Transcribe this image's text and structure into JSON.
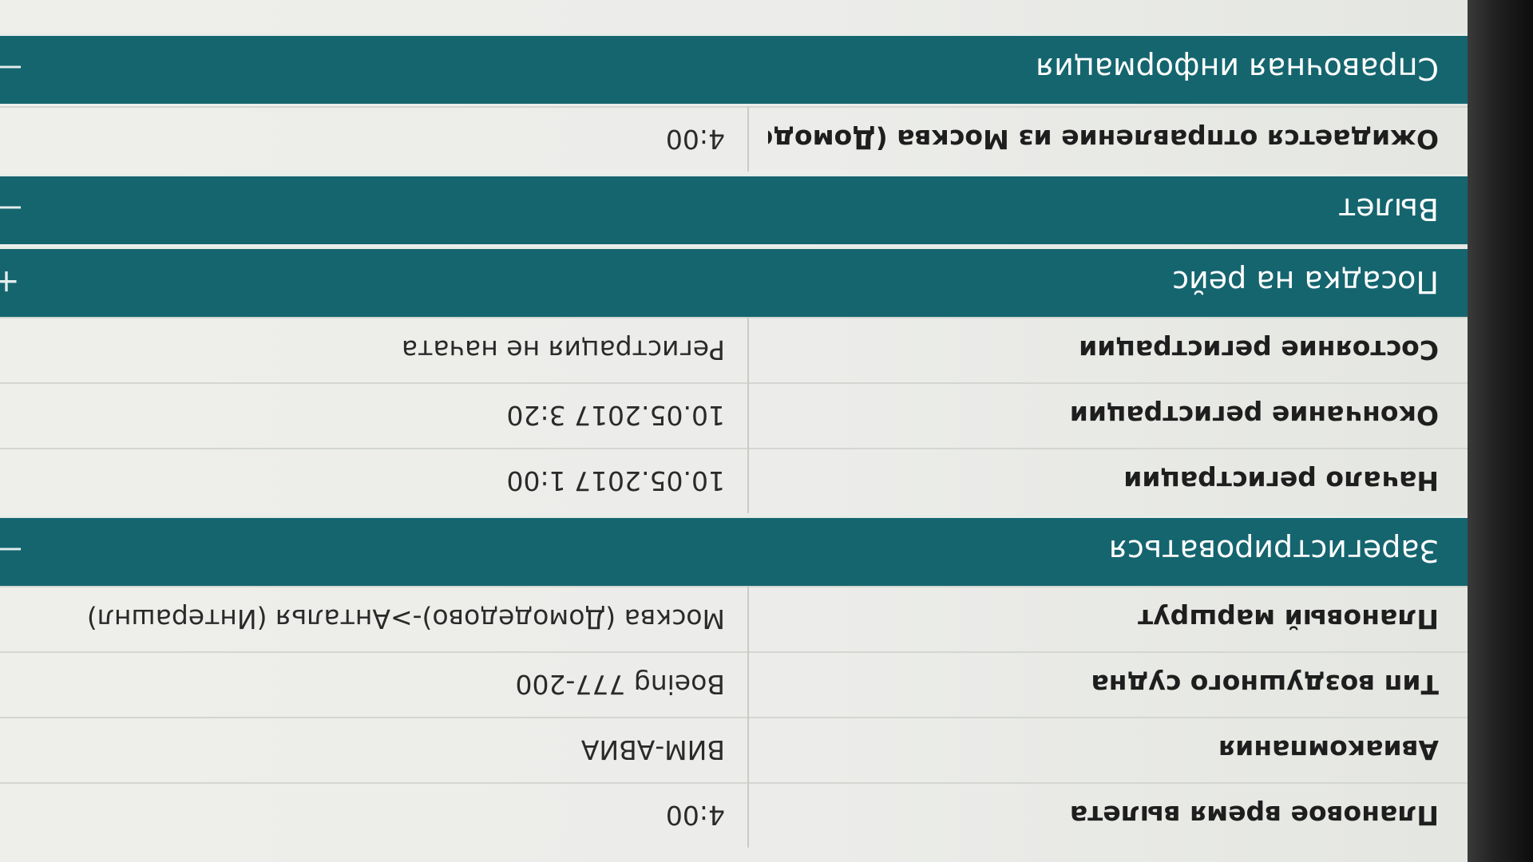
{
  "sections": {
    "flight_info": {
      "rows": [
        {
          "label": "Плановое время вылета",
          "value": "4:00"
        },
        {
          "label": "Авиакомпания",
          "value": "ВИМ-АВИА"
        },
        {
          "label": "Тип воздушного судна",
          "value": "Boeing 777-200"
        },
        {
          "label": "Плановый маршрут",
          "value": "Москва (Домодедово)->Анталья (Интерашнл)"
        }
      ]
    },
    "checkin": {
      "title": "Зарегистрироваться",
      "toggle": "—",
      "rows": [
        {
          "label": "Начало регистрации",
          "value": "10.05.2017 1:00"
        },
        {
          "label": "Окончание регистрации",
          "value": "10.05.2017 3:20"
        },
        {
          "label": "Состояние регистрации",
          "value": "Регистрация не начата"
        }
      ]
    },
    "boarding": {
      "title": "Посадка на рейс",
      "toggle": "+"
    },
    "departure": {
      "title": "Вылет",
      "toggle": "—",
      "rows": [
        {
          "label": "Ожидается отправление из Москва (Домодедово)",
          "value": "4:00"
        }
      ]
    },
    "reference": {
      "title": "Справочная информация",
      "toggle": "—"
    }
  },
  "colors": {
    "header_bg": "#15656f",
    "header_text": "#ffffff",
    "row_bg": "#ecedea"
  }
}
